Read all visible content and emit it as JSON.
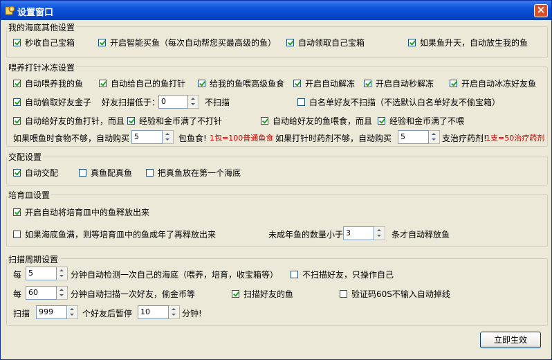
{
  "window": {
    "title": "设置窗口",
    "close_glyph": "×",
    "icon": "gear-settings-icon"
  },
  "groups": {
    "sea": {
      "label": "我的海底其他设置",
      "opts": [
        {
          "label": "秒收自己宝箱",
          "checked": true
        },
        {
          "label": "开启智能买鱼（每次自动帮您买最高级的鱼）",
          "checked": true
        },
        {
          "label": "自动领取自己宝箱",
          "checked": true
        },
        {
          "label": "如果鱼升天，自动放生我的鱼",
          "checked": true
        }
      ]
    },
    "feed": {
      "label": "喂养打针冰冻设置",
      "row1": [
        {
          "label": "自动喂养我的鱼",
          "checked": true
        },
        {
          "label": "自动给自己的鱼打针",
          "checked": true
        },
        {
          "label": "给我的鱼喂高级鱼食",
          "checked": true
        },
        {
          "label": "开启自动解冻",
          "checked": true
        },
        {
          "label": "开启自动秒解冻",
          "checked": true
        },
        {
          "label": "开启自动冰冻好友鱼",
          "checked": true
        }
      ],
      "steal_gold": {
        "label": "自动偷取好友金子",
        "checked": true
      },
      "scan_low_label": "好友扫描低于：",
      "scan_low_value": "0",
      "no_scan_label": "不扫描",
      "whitelist": {
        "label": "白名单好友不扫描（不选默认白名单好友不偷宝箱）",
        "checked": false
      },
      "inject_friend": {
        "label": "自动给好友的鱼打针，而且",
        "checked": true
      },
      "inject_full": {
        "label": "经验和金币满了不打针",
        "checked": true
      },
      "feed_friend": {
        "label": "自动给好友的鱼喂食，而且",
        "checked": true
      },
      "feed_full": {
        "label": "经验和金币满了不喂",
        "checked": true
      },
      "buy_food_label": "如果喂鱼时食物不够，自动购买",
      "buy_food_value": "5",
      "food_unit": "包鱼食!",
      "food_note": "1包=100普通鱼食",
      "buy_med_label": "如果打针时药剂不够，自动购买",
      "buy_med_value": "5",
      "med_unit": "支治疗药剂!",
      "med_note": "1支=50治疗药剂"
    },
    "mate": {
      "label": "交配设置",
      "opts": [
        {
          "label": "自动交配",
          "checked": true
        },
        {
          "label": "真鱼配真鱼",
          "checked": false
        },
        {
          "label": "把真鱼放在第一个海底",
          "checked": false
        }
      ]
    },
    "dish": {
      "label": "培育皿设置",
      "release": {
        "label": "开启自动将培育皿中的鱼释放出来",
        "checked": true
      },
      "full_wait": {
        "label": "如果海底鱼满，则等培育皿中的鱼成年了再释放出来",
        "checked": false
      },
      "min_label": "未成年鱼的数量小于",
      "min_value": "3",
      "min_suffix": "条才自动释放鱼"
    },
    "scan": {
      "label": "扫描周期设置",
      "every1": "每",
      "v1": "5",
      "s1": "分钟自动检测一次自己的海底（喂养，培育，收宝箱等）",
      "no_friends": {
        "label": "不扫描好友，只操作自己",
        "checked": false
      },
      "every2": "每",
      "v2": "60",
      "s2": "分钟自动扫描一次好友，偷金币等",
      "scan_fish": {
        "label": "扫描好友的鱼",
        "checked": true
      },
      "captcha": {
        "label": "验证码60S不输入自动掉线",
        "checked": false
      },
      "scan_lbl": "扫描",
      "v3": "999",
      "s3": "个好友后暂停",
      "v4": "10",
      "s4": "分钟!"
    }
  },
  "apply_button": "立即生效"
}
